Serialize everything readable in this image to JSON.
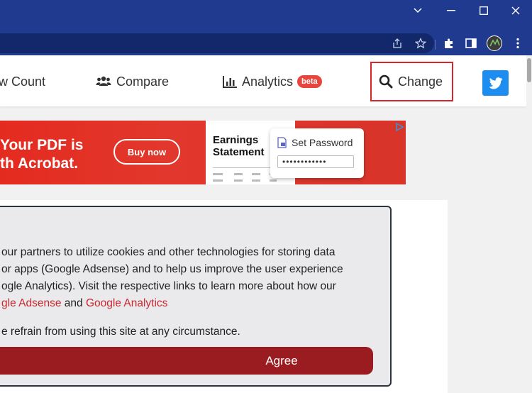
{
  "browser": {
    "window_controls": {
      "minimize": "—",
      "maximize": "☐",
      "close": "✕",
      "dropdown": "⌄"
    },
    "colors": {
      "frame": "#1f3a8e",
      "omnibox": "#13286a"
    }
  },
  "nav": {
    "items": [
      {
        "label": "w Count",
        "icon": "count-icon"
      },
      {
        "label": "Compare",
        "icon": "users-icon"
      },
      {
        "label": "Analytics",
        "icon": "bar-chart-icon",
        "badge": "beta"
      },
      {
        "label": "Change",
        "icon": "search-icon"
      }
    ],
    "twitter_icon": "twitter-icon"
  },
  "ad": {
    "headline_line1": "Your PDF is",
    "headline_line2": "th Acrobat.",
    "button": "Buy now",
    "doc_title_line1": "Earnings",
    "doc_title_line2": "Statement",
    "card_title": "Set Password",
    "password_mask": "••••••••••••"
  },
  "consent": {
    "line1": "our partners to utilize cookies and other technologies for storing data",
    "line2": "or apps (Google Adsense) and to help us improve the user experience",
    "line3": "ogle Analytics). Visit the respective links to learn more about how our",
    "link1": "gle Adsense",
    "and_text": " and ",
    "link2": "Google Analytics",
    "line5": "e refrain from using this site at any circumstance.",
    "agree_button": "Agree"
  }
}
